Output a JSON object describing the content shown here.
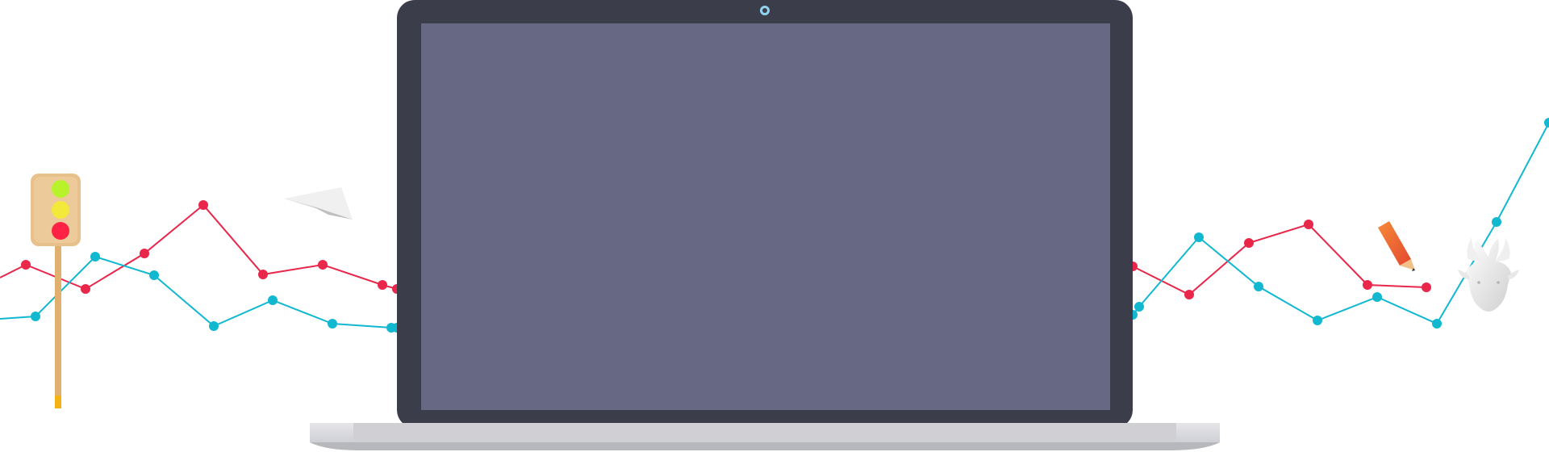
{
  "scene": {
    "background": "#ffffff"
  },
  "colors": {
    "red_line": "#e8274b",
    "cyan_line": "#12b8d0",
    "laptop_bezel": "#3c3d4a",
    "laptop_screen": "#676883",
    "laptop_base": "#d3d3d7",
    "laptop_base_shadow": "#b7b8bc",
    "camera": "#8fd3ef"
  },
  "icons": [
    "traffic-light-icon",
    "paper-plane-icon",
    "pencil-icon",
    "deer-head-icon",
    "laptop-icon",
    "camera-icon"
  ]
}
